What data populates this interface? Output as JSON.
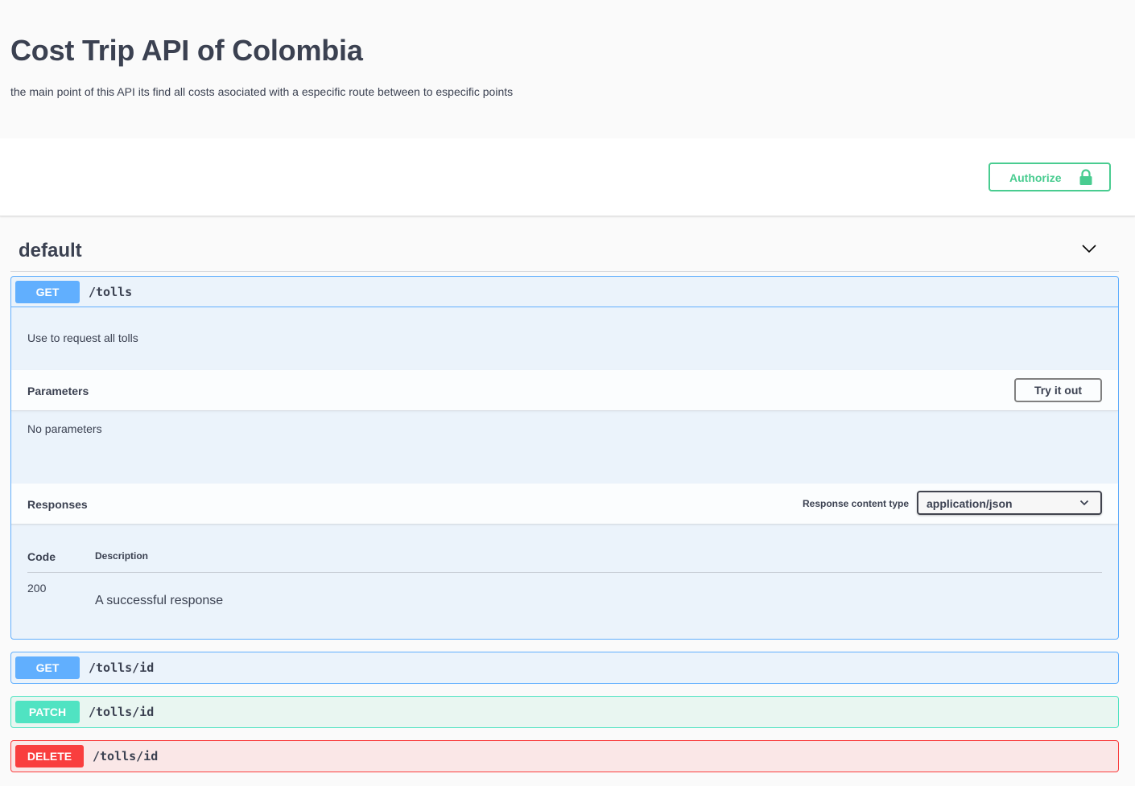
{
  "info": {
    "title": "Cost Trip API of Colombia",
    "description": "the main point of this API its find all costs asociated with a especific route between to especific points"
  },
  "auth": {
    "label": "Authorize",
    "color": "#49cc90"
  },
  "tag": {
    "name": "default"
  },
  "operations": [
    {
      "method": "GET",
      "path": "/tolls",
      "expanded": true,
      "description": "Use to request all tolls",
      "parameters_title": "Parameters",
      "try_label": "Try it out",
      "no_params": "No parameters",
      "responses_title": "Responses",
      "response_content_type_label": "Response content type",
      "response_content_type": "application/json",
      "table_headers": {
        "code": "Code",
        "description": "Description"
      },
      "responses": [
        {
          "code": "200",
          "description": "A successful response"
        }
      ]
    },
    {
      "method": "GET",
      "path": "/tolls/id",
      "expanded": false
    },
    {
      "method": "PATCH",
      "path": "/tolls/id",
      "expanded": false
    },
    {
      "method": "DELETE",
      "path": "/tolls/id",
      "expanded": false
    }
  ],
  "colors": {
    "get": "#61affe",
    "patch": "#50e3c2",
    "delete": "#f93e3e",
    "text": "#3b4151"
  }
}
